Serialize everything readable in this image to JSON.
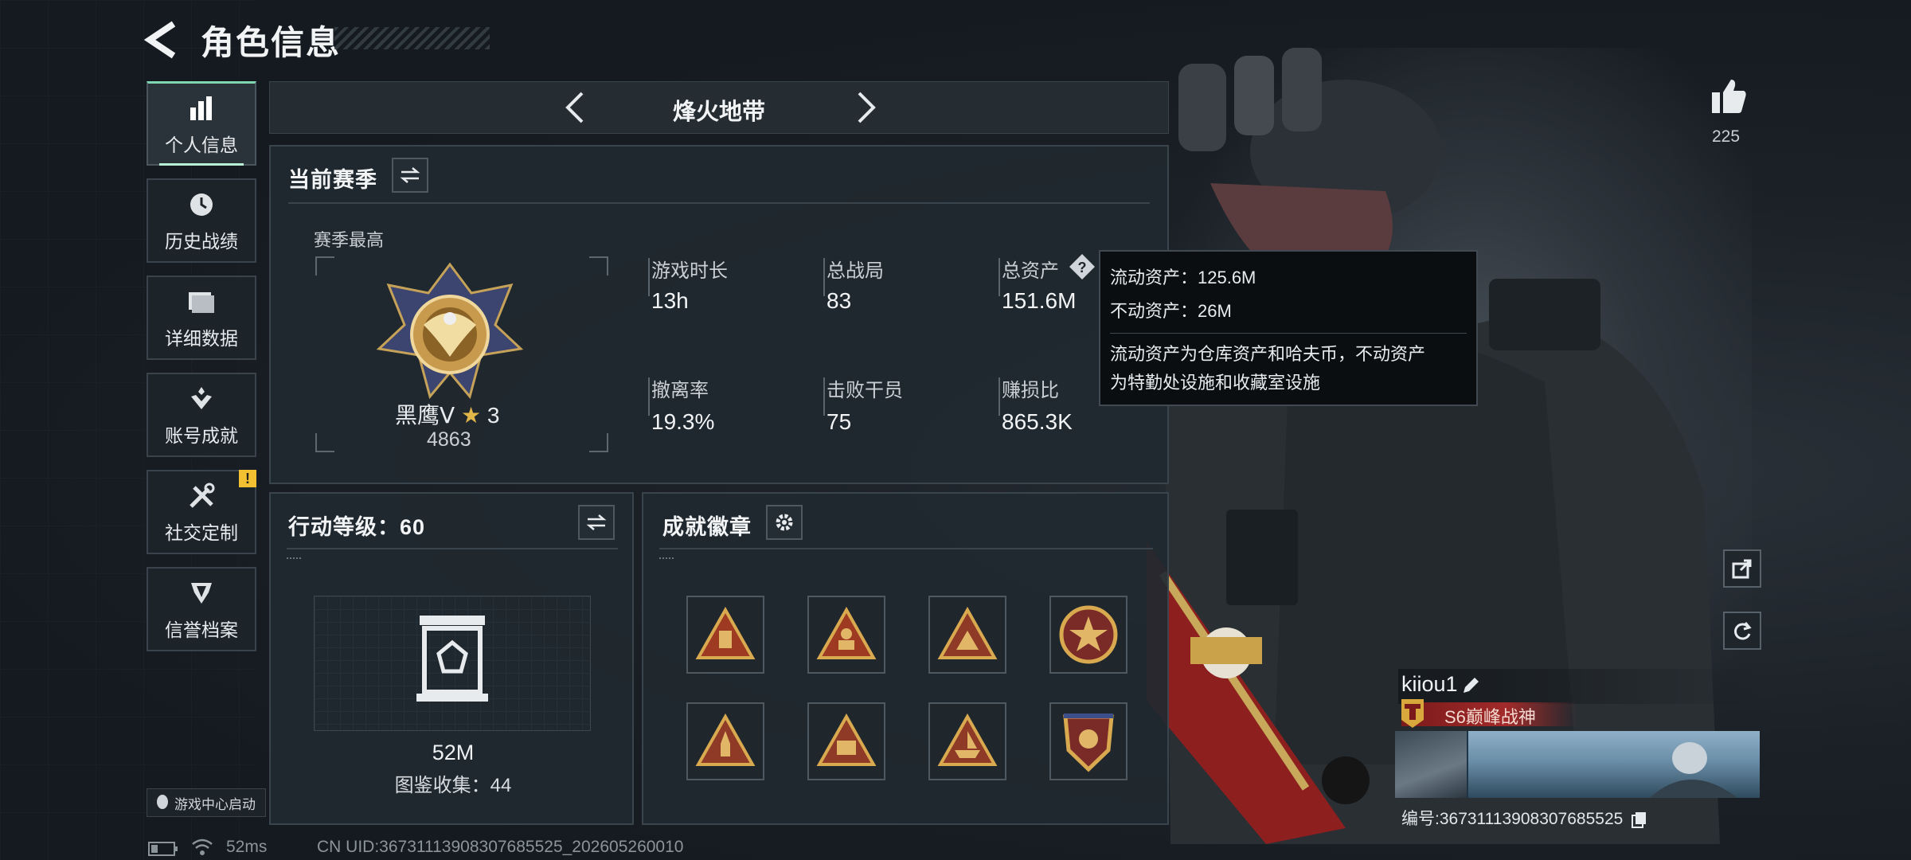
{
  "header": {
    "title": "角色信息"
  },
  "sidebar": {
    "items": [
      {
        "label": "个人信息",
        "icon": "bar-chart-icon",
        "active": true
      },
      {
        "label": "历史战绩",
        "icon": "clock-icon"
      },
      {
        "label": "详细数据",
        "icon": "folder-icon"
      },
      {
        "label": "账号成就",
        "icon": "achievement-icon"
      },
      {
        "label": "社交定制",
        "icon": "tools-icon",
        "alert": "!"
      },
      {
        "label": "信誉档案",
        "icon": "shield-icon"
      }
    ],
    "game_center": "游戏中心启动"
  },
  "mode": {
    "name": "烽火地带"
  },
  "season": {
    "title": "当前赛季",
    "best_label": "赛季最高",
    "rank": "黑鹰Ⅴ",
    "rank_stars": "3",
    "rank_score": "4863",
    "stats": [
      {
        "label": "游戏时长",
        "value": "13h"
      },
      {
        "label": "总战局",
        "value": "83"
      },
      {
        "label": "总资产",
        "value": "151.6M"
      },
      {
        "label": "撤离率",
        "value": "19.3%"
      },
      {
        "label": "击败干员",
        "value": "75"
      },
      {
        "label": "赚损比",
        "value": "865.3K"
      }
    ]
  },
  "tooltip": {
    "liquid": "流动资产：125.6M",
    "fixed": "不动资产：26M",
    "desc_line1": "流动资产为仓库资产和哈夫币，不动资产",
    "desc_line2": "为特勤处设施和收藏室设施"
  },
  "level": {
    "title": "行动等级：60",
    "value": "52M",
    "collection": "图鉴收集：44"
  },
  "badges": {
    "title": "成就徽章",
    "items": [
      {
        "icon": "supply-triangle-badge-icon"
      },
      {
        "icon": "soldier-triangle-badge-icon"
      },
      {
        "icon": "squad-triangle-badge-icon"
      },
      {
        "icon": "star-round-badge-icon"
      },
      {
        "icon": "rocket-triangle-badge-icon"
      },
      {
        "icon": "number-58-triangle-badge-icon"
      },
      {
        "icon": "boat-triangle-badge-icon"
      },
      {
        "icon": "shield-wing-badge-icon"
      }
    ]
  },
  "likes": {
    "count": "225"
  },
  "player": {
    "name": "kiiou1",
    "title": "S6巅峰战神",
    "id_text": "编号:3673111390830768552​5"
  },
  "status_bar": {
    "ping": "52ms",
    "uid": "CN UID:3673111390830768552​5_202605260010"
  },
  "colors": {
    "accent": "#7fd6b0",
    "alert": "#f2c030",
    "title_red": "#8a1d1d"
  }
}
